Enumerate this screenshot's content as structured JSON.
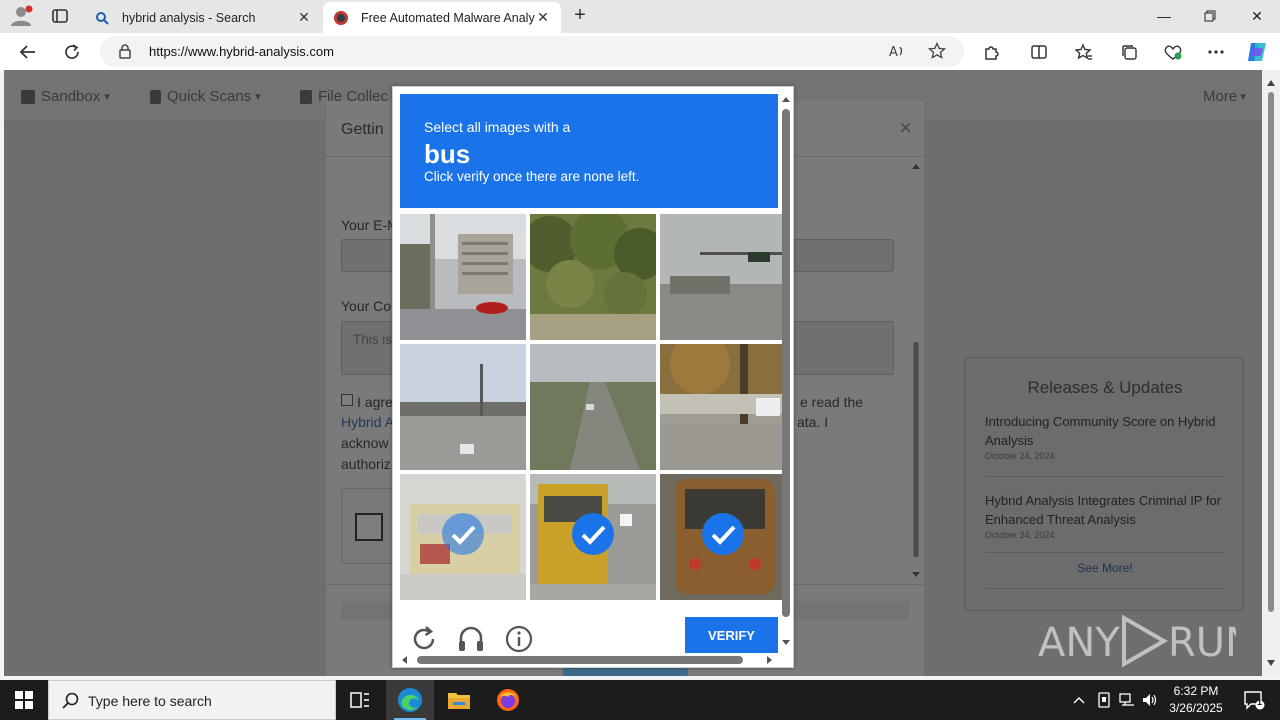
{
  "browser": {
    "tabs": [
      {
        "title": "hybrid analysis - Search",
        "icon": "search-icon"
      },
      {
        "title": "Free Automated Malware Analysis",
        "icon": "hybrid-analysis-favicon"
      }
    ],
    "url": "https://www.hybrid-analysis.com"
  },
  "site": {
    "nav": [
      {
        "label": "Sandbox",
        "caret": "▾"
      },
      {
        "label": "Quick Scans",
        "caret": "▾"
      },
      {
        "label": "File Collec"
      }
    ],
    "nav_right": {
      "label": "More",
      "caret": "▾"
    },
    "releases": {
      "title": "Releases & Updates",
      "items": [
        {
          "title": "Introducing Community Score on Hybrid Analysis",
          "date": "October 24, 2024"
        },
        {
          "title": "Hybrid Analysis Integrates Criminal IP for Enhanced Threat Analysis",
          "date": "October 24, 2024"
        }
      ],
      "see_more": "See More!"
    }
  },
  "modal": {
    "title": "Gettin",
    "close": "×",
    "email_label": "Your E-M",
    "comment_label": "Your Co",
    "comment_placeholder": "This is",
    "agree_text_left": "I agre",
    "agree_text_right": "e read the",
    "link_text": "Hybrid A",
    "line2_right": "ata. I",
    "line3_left": "acknow",
    "line4_left": "authoriz"
  },
  "captcha": {
    "instruction": "Select all images with a",
    "target": "bus",
    "subtext": "Click verify once there are none left.",
    "verify_label": "VERIFY",
    "tiles": [
      {
        "scene": "street-buildings",
        "selected": false
      },
      {
        "scene": "trees",
        "selected": false
      },
      {
        "scene": "road-traffic-light",
        "selected": false
      },
      {
        "scene": "overpass-street",
        "selected": false
      },
      {
        "scene": "highway",
        "selected": false
      },
      {
        "scene": "road-tree",
        "selected": false
      },
      {
        "scene": "bus-front",
        "selected": true
      },
      {
        "scene": "school-bus",
        "selected": true
      },
      {
        "scene": "bus-rear",
        "selected": true
      }
    ]
  },
  "taskbar": {
    "search_placeholder": "Type here to search",
    "time": "6:32 PM",
    "date": "3/26/2025",
    "notification_count": "1"
  },
  "watermark": "ANY RUN",
  "colors": {
    "captcha_blue": "#1a73e8",
    "overlay_gray": "#6e6e6e",
    "taskbar": "#1c1c1c"
  }
}
